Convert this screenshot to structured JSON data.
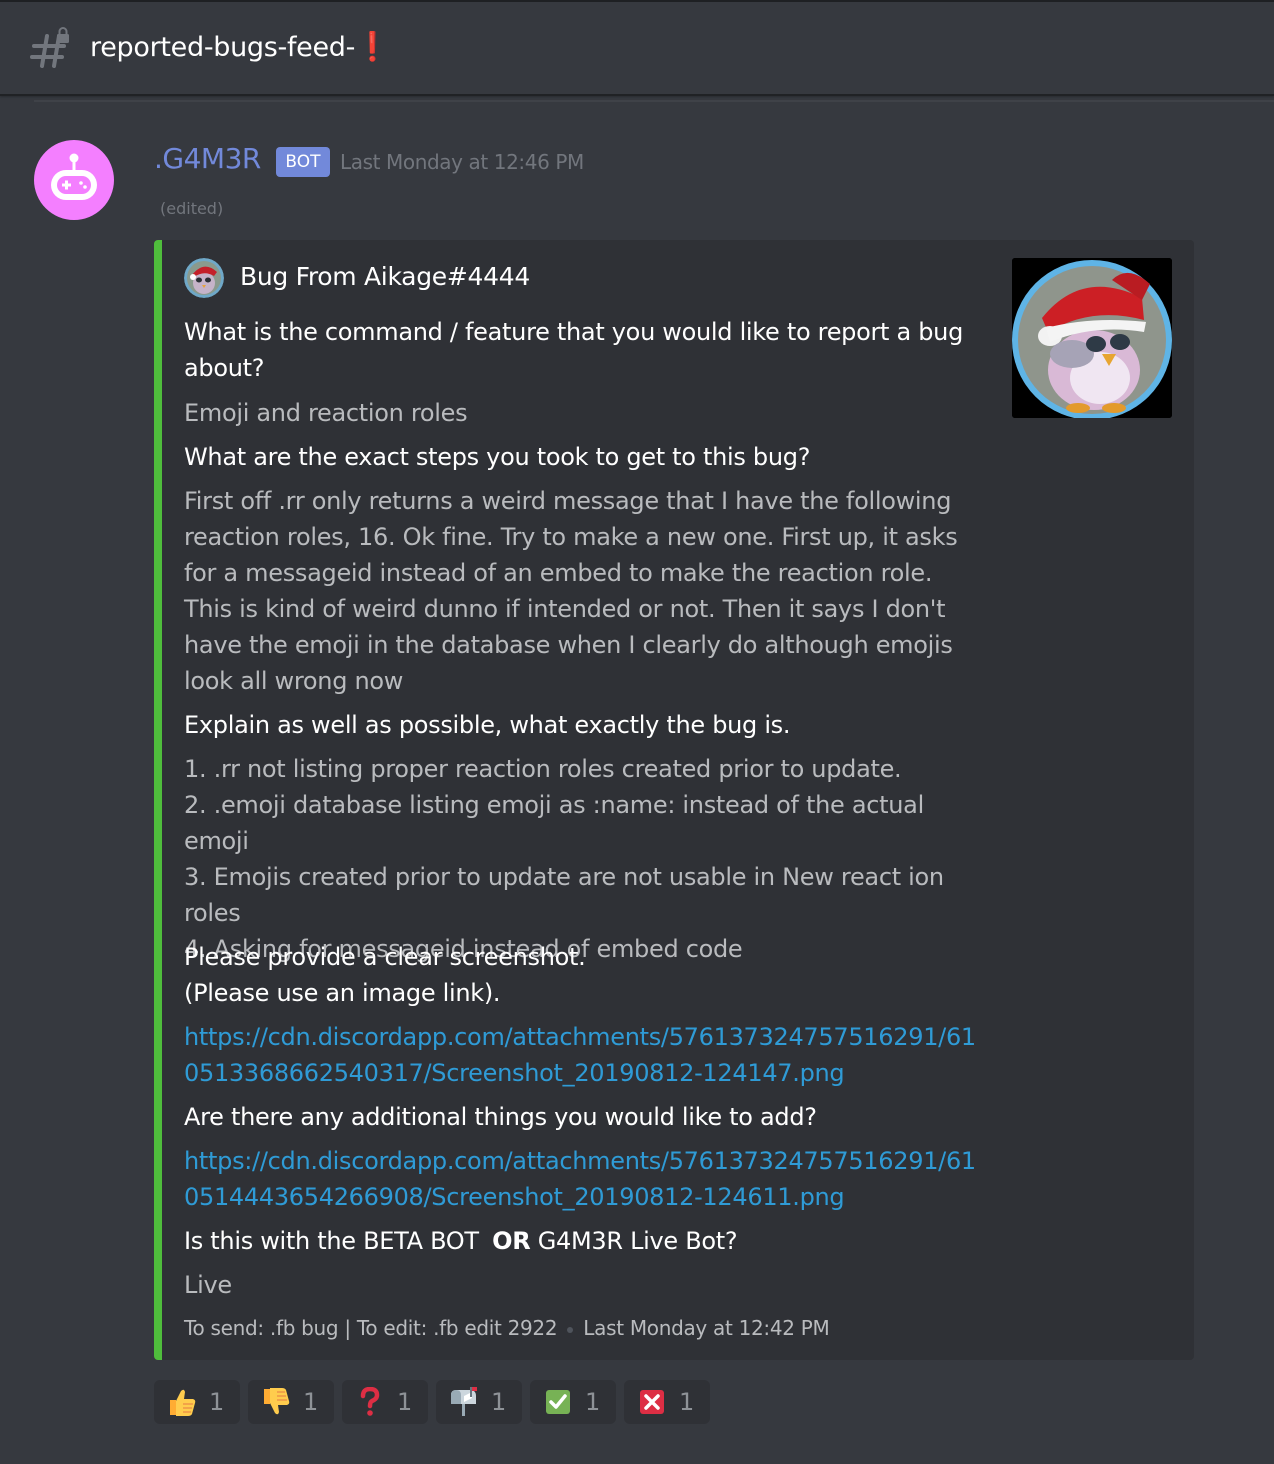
{
  "channel": {
    "name": "reported-bugs-feed-",
    "name_emoji": "❗",
    "icon": "locked-hash-channel-icon"
  },
  "message": {
    "author": ".G4M3R",
    "bot_tag": "BOT",
    "timestamp": "Last Monday at 12:46 PM",
    "edited": "(edited)",
    "avatar_color": "#f47fff",
    "embed": {
      "color": "#4fbd3c",
      "author": "Bug From Aikage#4444",
      "fields": [
        {
          "name": "What is the command / feature that you would like to report a bug about?",
          "value": "Emoji and reaction roles"
        },
        {
          "name": "What are the exact steps you took to get to this bug?",
          "value": "First off .rr only returns a weird message that I have the following reaction roles, 16. Ok fine. Try to make a new one. First up, it asks for a messageid instead of an embed to make the reaction role. This is kind of weird dunno if intended or not. Then it says I don't have the emoji in the database when I clearly do although emojis look all wrong now"
        },
        {
          "name": "Explain as well as possible, what exactly the bug is.",
          "value_lines": [
            "1. .rr not listing proper reaction roles created prior to update.",
            "2. .emoji database listing emoji as :name: instead of the actual emoji",
            "3. Emojis created prior to update are not usable in New react ion roles",
            "4. Asking for messageid instead of embed code"
          ]
        },
        {
          "name_lines": [
            "Please provide a clear screenshot.",
            "(Please use an image link)."
          ],
          "link": "https://cdn.discordapp.com/attachments/576137324757516291/610513368662540317/Screenshot_20190812-124147.png"
        },
        {
          "name": "Are there any additional things you would like to add?",
          "link": "https://cdn.discordapp.com/attachments/576137324757516291/610514443654266908/Screenshot_20190812-124611.png"
        },
        {
          "name_pre": "Is this with the BETA BOT ",
          "name_bold": "OR",
          "name_post": " G4M3R Live Bot?",
          "value": "Live"
        }
      ],
      "footer_text": "To send: .fb bug | To edit: .fb edit 2922",
      "footer_timestamp": "Last Monday at 12:42 PM"
    },
    "reactions": [
      {
        "emoji": "thumbs-up-icon",
        "count": "1"
      },
      {
        "emoji": "thumbs-down-icon",
        "count": "1"
      },
      {
        "emoji": "question-mark-icon",
        "count": "1"
      },
      {
        "emoji": "mailbox-icon",
        "count": "1"
      },
      {
        "emoji": "check-mark-icon",
        "count": "1"
      },
      {
        "emoji": "cross-mark-icon",
        "count": "1"
      }
    ]
  }
}
